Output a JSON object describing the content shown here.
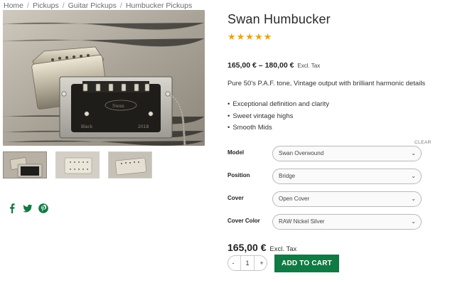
{
  "breadcrumb": {
    "items": [
      "Home",
      "Pickups",
      "Guitar Pickups",
      "Humbucker Pickups"
    ],
    "separator": "/"
  },
  "product": {
    "title": "Swan Humbucker",
    "rating_stars": "★★★★★",
    "rating_value": 5,
    "price_range_low": "165,00 €",
    "price_range_dash": "–",
    "price_range_high": "180,00 €",
    "price_range_tax": "Excl. Tax",
    "description": "Pure 50's P.A.F. tone, Vintage output with brilliant harmonic details",
    "features": [
      "Exceptional definition and clarity",
      "Sweet vintage highs",
      "Smooth Mids"
    ]
  },
  "options": {
    "clear_label": "CLEAR",
    "rows": [
      {
        "label": "Model",
        "value": "Swan Overwound"
      },
      {
        "label": "Position",
        "value": "Bridge"
      },
      {
        "label": "Cover",
        "value": "Open Cover"
      },
      {
        "label": "Cover Color",
        "value": "RAW Nickel Silver"
      }
    ]
  },
  "purchase": {
    "price": "165,00 €",
    "tax": "Excl. Tax",
    "qty_minus": "-",
    "qty_value": "1",
    "qty_plus": "+",
    "add_to_cart": "ADD TO CART"
  },
  "gallery": {
    "thumbnail_count": 3,
    "active_index": 0,
    "pickup_engraving": [
      "Swan",
      "Black",
      "2018"
    ]
  },
  "social": {
    "icons": [
      "facebook-icon",
      "twitter-icon",
      "pinterest-icon"
    ],
    "color": "#0f7a43"
  },
  "colors": {
    "accent": "#0f7a43",
    "stars": "#e8a317"
  }
}
